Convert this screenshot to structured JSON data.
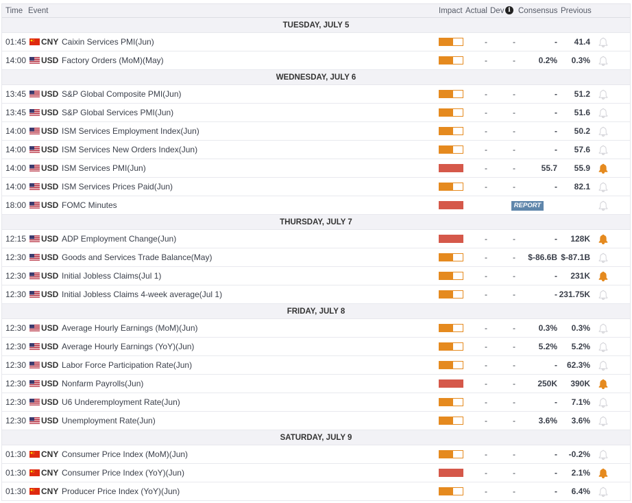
{
  "header": {
    "time": "Time",
    "event": "Event",
    "impact": "Impact",
    "actual": "Actual",
    "dev": "Dev",
    "consensus": "Consensus",
    "previous": "Previous"
  },
  "report_label": "REPORT",
  "colors": {
    "medium": "#e58a1f",
    "high": "#d5584a",
    "bell_active": "#e58a1f",
    "bell_inactive": "#d9d9dd"
  },
  "days": [
    {
      "label": "TUESDAY, JULY 5",
      "events": [
        {
          "time": "01:45",
          "flag": "cn",
          "currency": "CNY",
          "event": "Caixin Services PMI(Jun)",
          "impact": "medium",
          "actual": "-",
          "dev": "-",
          "consensus": "-",
          "previous": "41.4",
          "alert": false
        },
        {
          "time": "14:00",
          "flag": "us",
          "currency": "USD",
          "event": "Factory Orders (MoM)(May)",
          "impact": "medium",
          "actual": "-",
          "dev": "-",
          "consensus": "0.2%",
          "previous": "0.3%",
          "alert": false
        }
      ]
    },
    {
      "label": "WEDNESDAY, JULY 6",
      "events": [
        {
          "time": "13:45",
          "flag": "us",
          "currency": "USD",
          "event": "S&P Global Composite PMI(Jun)",
          "impact": "medium",
          "actual": "-",
          "dev": "-",
          "consensus": "-",
          "previous": "51.2",
          "alert": false
        },
        {
          "time": "13:45",
          "flag": "us",
          "currency": "USD",
          "event": "S&P Global Services PMI(Jun)",
          "impact": "medium",
          "actual": "-",
          "dev": "-",
          "consensus": "-",
          "previous": "51.6",
          "alert": false
        },
        {
          "time": "14:00",
          "flag": "us",
          "currency": "USD",
          "event": "ISM Services Employment Index(Jun)",
          "impact": "medium",
          "actual": "-",
          "dev": "-",
          "consensus": "-",
          "previous": "50.2",
          "alert": false
        },
        {
          "time": "14:00",
          "flag": "us",
          "currency": "USD",
          "event": "ISM Services New Orders Index(Jun)",
          "impact": "medium",
          "actual": "-",
          "dev": "-",
          "consensus": "-",
          "previous": "57.6",
          "alert": false
        },
        {
          "time": "14:00",
          "flag": "us",
          "currency": "USD",
          "event": "ISM Services PMI(Jun)",
          "impact": "high",
          "actual": "-",
          "dev": "-",
          "consensus": "55.7",
          "previous": "55.9",
          "alert": true
        },
        {
          "time": "14:00",
          "flag": "us",
          "currency": "USD",
          "event": "ISM Services Prices Paid(Jun)",
          "impact": "medium",
          "actual": "-",
          "dev": "-",
          "consensus": "-",
          "previous": "82.1",
          "alert": false
        },
        {
          "time": "18:00",
          "flag": "us",
          "currency": "USD",
          "event": "FOMC Minutes",
          "impact": "high",
          "report": true,
          "alert": false
        }
      ]
    },
    {
      "label": "THURSDAY, JULY 7",
      "events": [
        {
          "time": "12:15",
          "flag": "us",
          "currency": "USD",
          "event": "ADP Employment Change(Jun)",
          "impact": "high",
          "actual": "-",
          "dev": "-",
          "consensus": "-",
          "previous": "128K",
          "alert": true
        },
        {
          "time": "12:30",
          "flag": "us",
          "currency": "USD",
          "event": "Goods and Services Trade Balance(May)",
          "impact": "medium",
          "actual": "-",
          "dev": "-",
          "consensus": "$-86.6B",
          "previous": "$-87.1B",
          "alert": false
        },
        {
          "time": "12:30",
          "flag": "us",
          "currency": "USD",
          "event": "Initial Jobless Claims(Jul 1)",
          "impact": "medium",
          "actual": "-",
          "dev": "-",
          "consensus": "-",
          "previous": "231K",
          "alert": true
        },
        {
          "time": "12:30",
          "flag": "us",
          "currency": "USD",
          "event": "Initial Jobless Claims 4-week average(Jul 1)",
          "impact": "medium",
          "actual": "-",
          "dev": "-",
          "consensus": "-",
          "previous": "231.75K",
          "alert": false
        }
      ]
    },
    {
      "label": "FRIDAY, JULY 8",
      "events": [
        {
          "time": "12:30",
          "flag": "us",
          "currency": "USD",
          "event": "Average Hourly Earnings (MoM)(Jun)",
          "impact": "medium",
          "actual": "-",
          "dev": "-",
          "consensus": "0.3%",
          "previous": "0.3%",
          "alert": false
        },
        {
          "time": "12:30",
          "flag": "us",
          "currency": "USD",
          "event": "Average Hourly Earnings (YoY)(Jun)",
          "impact": "medium",
          "actual": "-",
          "dev": "-",
          "consensus": "5.2%",
          "previous": "5.2%",
          "alert": false
        },
        {
          "time": "12:30",
          "flag": "us",
          "currency": "USD",
          "event": "Labor Force Participation Rate(Jun)",
          "impact": "medium",
          "actual": "-",
          "dev": "-",
          "consensus": "-",
          "previous": "62.3%",
          "alert": false
        },
        {
          "time": "12:30",
          "flag": "us",
          "currency": "USD",
          "event": "Nonfarm Payrolls(Jun)",
          "impact": "high",
          "actual": "-",
          "dev": "-",
          "consensus": "250K",
          "previous": "390K",
          "alert": true
        },
        {
          "time": "12:30",
          "flag": "us",
          "currency": "USD",
          "event": "U6 Underemployment Rate(Jun)",
          "impact": "medium",
          "actual": "-",
          "dev": "-",
          "consensus": "-",
          "previous": "7.1%",
          "alert": false
        },
        {
          "time": "12:30",
          "flag": "us",
          "currency": "USD",
          "event": "Unemployment Rate(Jun)",
          "impact": "medium",
          "actual": "-",
          "dev": "-",
          "consensus": "3.6%",
          "previous": "3.6%",
          "alert": false
        }
      ]
    },
    {
      "label": "SATURDAY, JULY 9",
      "events": [
        {
          "time": "01:30",
          "flag": "cn",
          "currency": "CNY",
          "event": "Consumer Price Index (MoM)(Jun)",
          "impact": "medium",
          "actual": "-",
          "dev": "-",
          "consensus": "-",
          "previous": "-0.2%",
          "alert": false
        },
        {
          "time": "01:30",
          "flag": "cn",
          "currency": "CNY",
          "event": "Consumer Price Index (YoY)(Jun)",
          "impact": "high",
          "actual": "-",
          "dev": "-",
          "consensus": "-",
          "previous": "2.1%",
          "alert": true
        },
        {
          "time": "01:30",
          "flag": "cn",
          "currency": "CNY",
          "event": "Producer Price Index (YoY)(Jun)",
          "impact": "medium",
          "actual": "-",
          "dev": "-",
          "consensus": "-",
          "previous": "6.4%",
          "alert": false
        }
      ]
    }
  ]
}
